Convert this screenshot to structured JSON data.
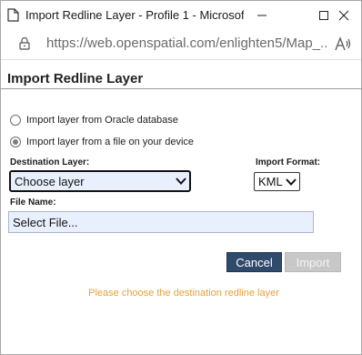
{
  "window": {
    "title": "Import Redline Layer - Profile 1 - Microsoft...",
    "icons": {
      "app": "page-icon",
      "minimize": "minimize-icon",
      "maximize": "maximize-icon",
      "close": "close-icon"
    }
  },
  "address_bar": {
    "url": "https://web.openspatial.com/enlighten5/Map_...",
    "icons": {
      "lock": "lock-icon",
      "read_aloud": "read-aloud-icon"
    }
  },
  "dialog": {
    "title": "Import Redline Layer",
    "source_options": [
      {
        "label": "Import layer from Oracle database",
        "checked": false
      },
      {
        "label": "Import layer from a file on your device",
        "checked": true
      }
    ],
    "destination_layer": {
      "label": "Destination Layer:",
      "selected": "Choose layer"
    },
    "import_format": {
      "label": "Import Format:",
      "selected": "KML"
    },
    "file_name": {
      "label": "File Name:",
      "value": "Select File..."
    },
    "buttons": {
      "cancel": "Cancel",
      "import": "Import"
    },
    "status_message": "Please choose the destination redline layer"
  },
  "colors": {
    "cancel_bg": "#2f4a6b",
    "import_disabled_bg": "#c8c8c8",
    "status_text": "#e8a13a",
    "input_bg": "#e8f0fe"
  }
}
